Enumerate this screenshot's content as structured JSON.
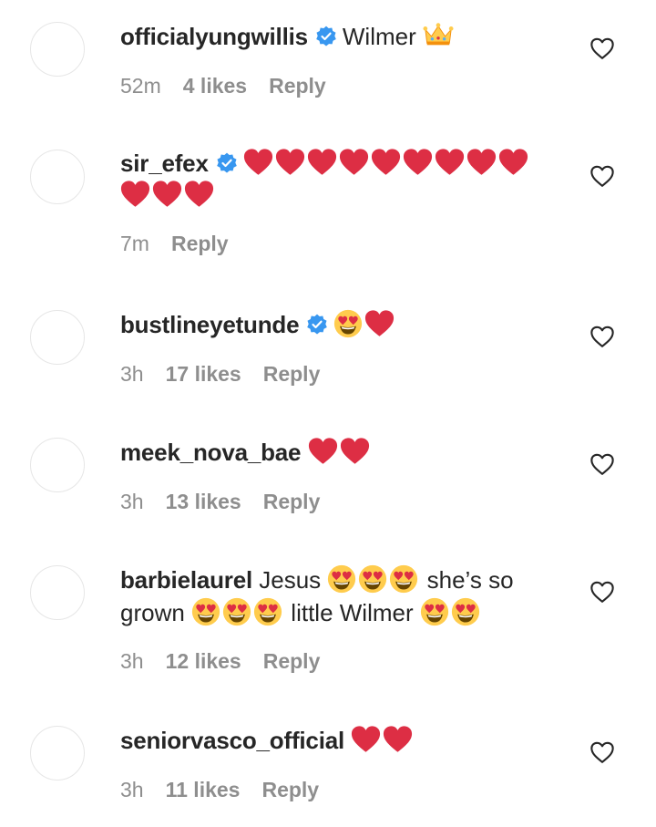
{
  "comments": [
    {
      "username": "officialyungwillis",
      "verified": true,
      "text_before": "Wilmer",
      "emojis": [
        "crown"
      ],
      "text_after": "",
      "time": "52m",
      "likes": "4 likes",
      "reply": "Reply"
    },
    {
      "username": "sir_efex",
      "verified": true,
      "text_before": "",
      "emojis": [
        "red-heart",
        "red-heart",
        "red-heart",
        "red-heart",
        "red-heart",
        "red-heart",
        "red-heart",
        "red-heart",
        "red-heart",
        "red-heart",
        "red-heart",
        "red-heart"
      ],
      "text_after": "",
      "time": "7m",
      "likes": "",
      "reply": "Reply"
    },
    {
      "username": "bustlineyetunde",
      "verified": true,
      "text_before": "",
      "emojis": [
        "heart-eyes",
        "red-heart"
      ],
      "text_after": "",
      "time": "3h",
      "likes": "17 likes",
      "reply": "Reply"
    },
    {
      "username": "meek_nova_bae",
      "verified": false,
      "text_before": "",
      "emojis": [
        "red-heart",
        "red-heart"
      ],
      "text_after": "",
      "time": "3h",
      "likes": "13 likes",
      "reply": "Reply"
    },
    {
      "username": "barbielaurel",
      "verified": false,
      "text_before": "Jesus",
      "emojis": [
        "heart-eyes",
        "heart-eyes",
        "heart-eyes"
      ],
      "text_after": "she’s so grown",
      "emojis_2": [
        "heart-eyes",
        "heart-eyes",
        "heart-eyes"
      ],
      "text_after_2": "little Wilmer",
      "emojis_3": [
        "heart-eyes",
        "heart-eyes"
      ],
      "time": "3h",
      "likes": "12 likes",
      "reply": "Reply"
    },
    {
      "username": "seniorvasco_official",
      "verified": false,
      "text_before": "",
      "emojis": [
        "red-heart",
        "red-heart"
      ],
      "text_after": "",
      "time": "3h",
      "likes": "11 likes",
      "reply": "Reply"
    }
  ],
  "colors": {
    "username": "#262626",
    "meta": "#8e8e8e",
    "verified_badge": "#3897f0",
    "heart_emoji": "#dd2e44",
    "avatar_border": "#e6e6e6"
  },
  "icons": {
    "verified": "verified-badge-icon",
    "like": "heart-outline-icon"
  }
}
